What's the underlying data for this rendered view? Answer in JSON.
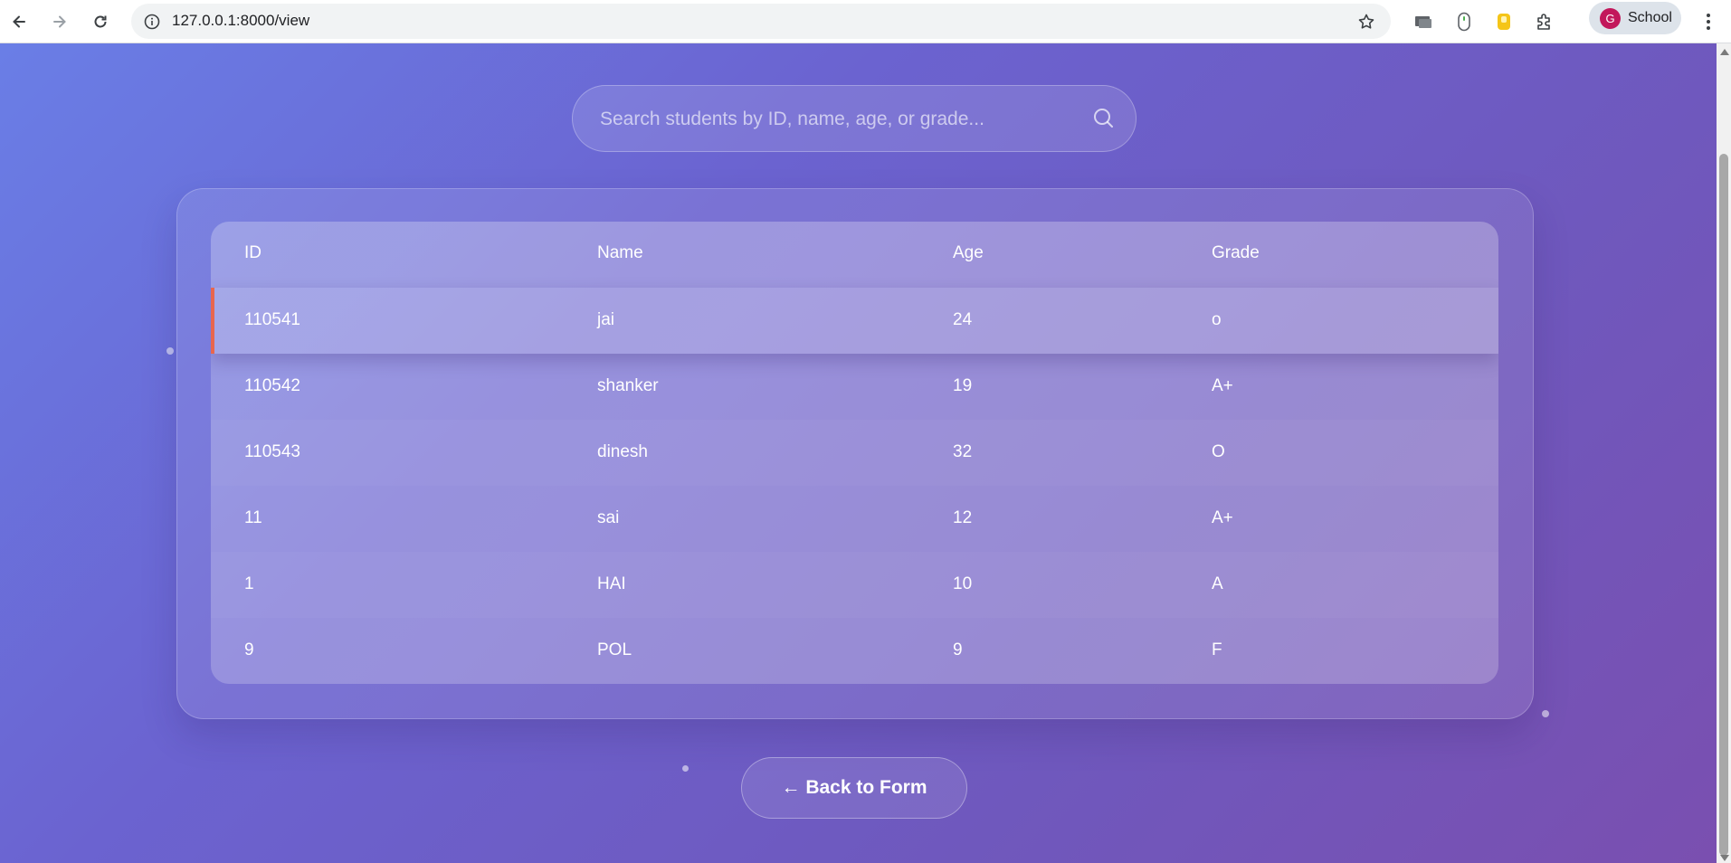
{
  "browser": {
    "url": "127.0.0.1:8000/view",
    "profile_name": "School",
    "profile_initial": "G"
  },
  "search": {
    "placeholder": "Search students by ID, name, age, or grade..."
  },
  "table": {
    "headers": [
      "ID",
      "Name",
      "Age",
      "Grade"
    ],
    "rows": [
      [
        "110541",
        "jai",
        "24",
        "o"
      ],
      [
        "110542",
        "shanker",
        "19",
        "A+"
      ],
      [
        "110543",
        "dinesh",
        "32",
        "O"
      ],
      [
        "11",
        "sai",
        "12",
        "A+"
      ],
      [
        "1",
        "HAI",
        "10",
        "A"
      ],
      [
        "9",
        "POL",
        "9",
        "F"
      ]
    ]
  },
  "back_button": {
    "label": "← Back to Form"
  },
  "colors": {
    "accent_row_border": "#e8664e",
    "bg_start": "#6a7ee6",
    "bg_end": "#7a4fb0"
  }
}
